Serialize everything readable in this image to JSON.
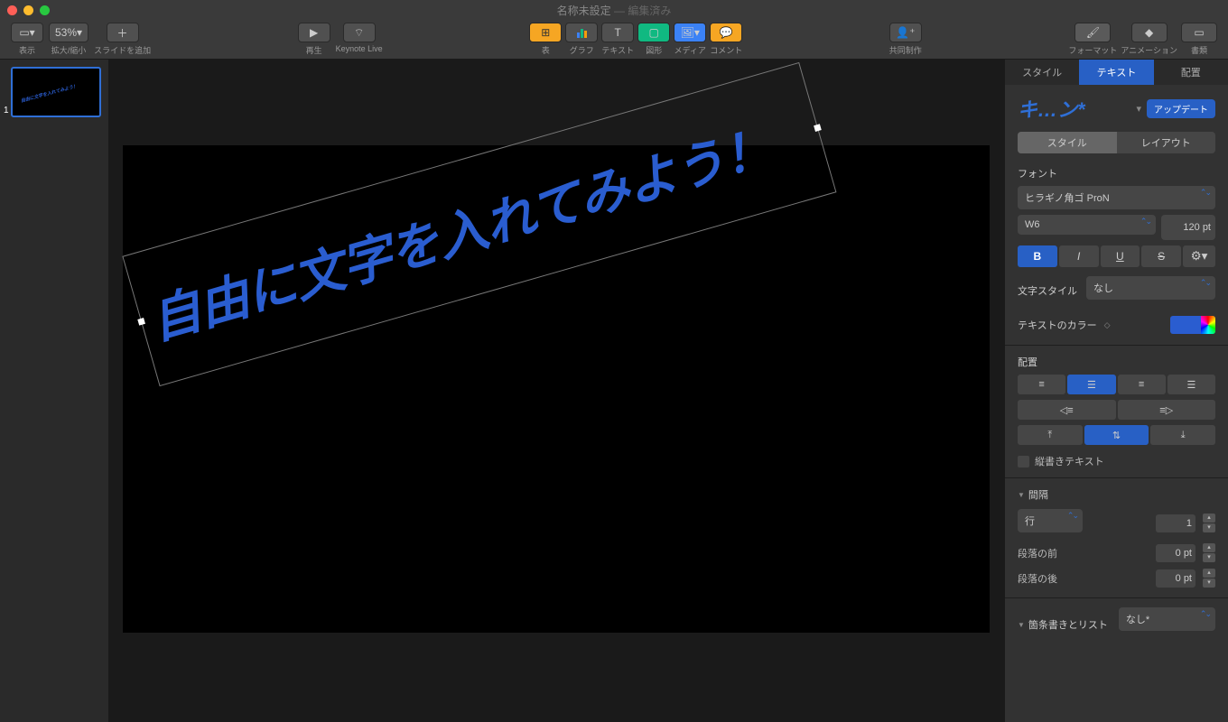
{
  "window": {
    "title": "名称未設定",
    "subtitle": "— 編集済み"
  },
  "toolbar": {
    "view": "表示",
    "zoom_value": "53%",
    "zoom_label": "拡大/縮小",
    "add_slide": "スライドを追加",
    "play": "再生",
    "keynote_live": "Keynote Live",
    "table": "表",
    "chart": "グラフ",
    "text": "テキスト",
    "shape": "図形",
    "media": "メディア",
    "comment": "コメント",
    "collaborate": "共同制作",
    "format": "フォーマット",
    "animate": "アニメーション",
    "document": "書類"
  },
  "sidebar": {
    "slide_number": "1"
  },
  "canvas": {
    "text": "自由に文字を入れてみよう！"
  },
  "inspector": {
    "tabs": {
      "style": "スタイル",
      "text": "テキスト",
      "arrange": "配置"
    },
    "style_name": "キ…ン*",
    "update_btn": "アップデート",
    "sub_tabs": {
      "style": "スタイル",
      "layout": "レイアウト"
    },
    "font_label": "フォント",
    "font_family": "ヒラギノ角ゴ ProN",
    "font_weight": "W6",
    "font_size": "120 pt",
    "char_style_label": "文字スタイル",
    "char_style_value": "なし",
    "text_color_label": "テキストのカラー",
    "align_label": "配置",
    "vertical_text": "縦書きテキスト",
    "spacing_label": "間隔",
    "line_label": "行",
    "line_value": "1",
    "before_label": "段落の前",
    "before_value": "0 pt",
    "after_label": "段落の後",
    "after_value": "0 pt",
    "bullets_label": "箇条書きとリスト",
    "bullets_value": "なし*"
  }
}
